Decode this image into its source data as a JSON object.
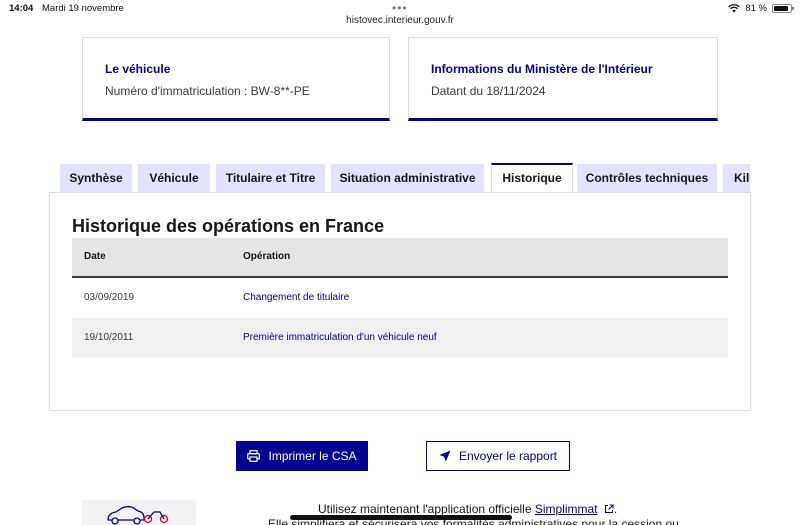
{
  "status_bar": {
    "time": "14:04",
    "date": "Mardi 19 novembre",
    "url": "histovec.interieur.gouv.fr",
    "battery": "81 %",
    "menu_dots": "•••"
  },
  "cards": [
    {
      "title": "Le véhicule",
      "text": "Numéro d'immatriculation : BW-8**-PE"
    },
    {
      "title": "Informations du Ministère de l'Intérieur",
      "text": "Datant du 18/11/2024"
    }
  ],
  "tabs": [
    {
      "label": "Synthèse",
      "active": false
    },
    {
      "label": "Véhicule",
      "active": false
    },
    {
      "label": "Titulaire et Titre",
      "active": false
    },
    {
      "label": "Situation administrative",
      "active": false
    },
    {
      "label": "Historique",
      "active": true
    },
    {
      "label": "Contrôles techniques",
      "active": false
    },
    {
      "label": "Kilo",
      "active": false
    }
  ],
  "history": {
    "title": "Historique des opérations en France",
    "columns": [
      "Date",
      "Opération"
    ],
    "rows": [
      {
        "date": "03/09/2019",
        "operation": "Changement de titulaire"
      },
      {
        "date": "19/10/2011",
        "operation": "Première immatriculation d'un véhicule neuf"
      }
    ]
  },
  "actions": {
    "print_label": "Imprimer le CSA",
    "send_label": "Envoyer le rapport"
  },
  "footer": {
    "text_prefix": "Utilisez maintenant l'application officielle",
    "link_label": "Simplimmat",
    "text_suffix": ".",
    "cut_line": "Elle simplifiera et sécurisera vos formalités administratives pour la cession ou"
  },
  "colors": {
    "brand_blue": "#000091",
    "tab_bg": "#e3e3fd"
  }
}
